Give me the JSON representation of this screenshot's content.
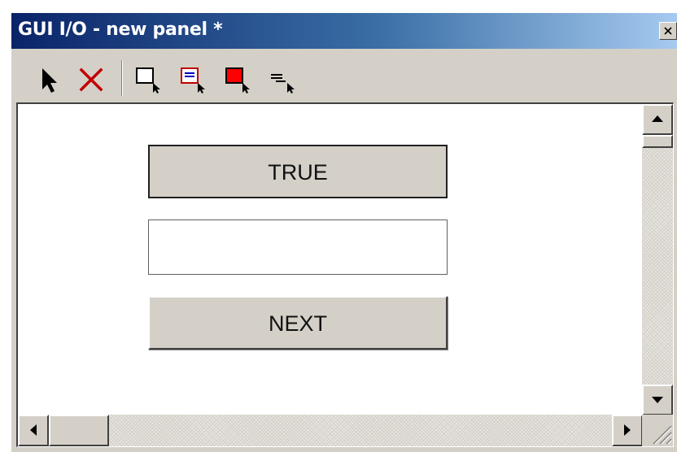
{
  "window": {
    "title": "GUI I/O - new panel *",
    "close_label": "×"
  },
  "toolbar": {
    "tools": [
      {
        "name": "select-pointer",
        "icon": "arrow-pointer-icon"
      },
      {
        "name": "delete",
        "icon": "red-x-icon"
      },
      {
        "name": "add-button",
        "icon": "button-cursor-icon"
      },
      {
        "name": "add-textbox",
        "icon": "textbox-cursor-icon"
      },
      {
        "name": "add-indicator",
        "icon": "red-box-cursor-icon"
      },
      {
        "name": "add-label",
        "icon": "label-lines-cursor-icon"
      }
    ]
  },
  "panel": {
    "true_button_label": "TRUE",
    "input_value": "",
    "next_button_label": "NEXT"
  },
  "colors": {
    "titlebar_start": "#0a246a",
    "titlebar_end": "#a6caf0",
    "face": "#d4d0c8",
    "delete_red": "#c00000",
    "indicator_red": "#ff0000"
  }
}
